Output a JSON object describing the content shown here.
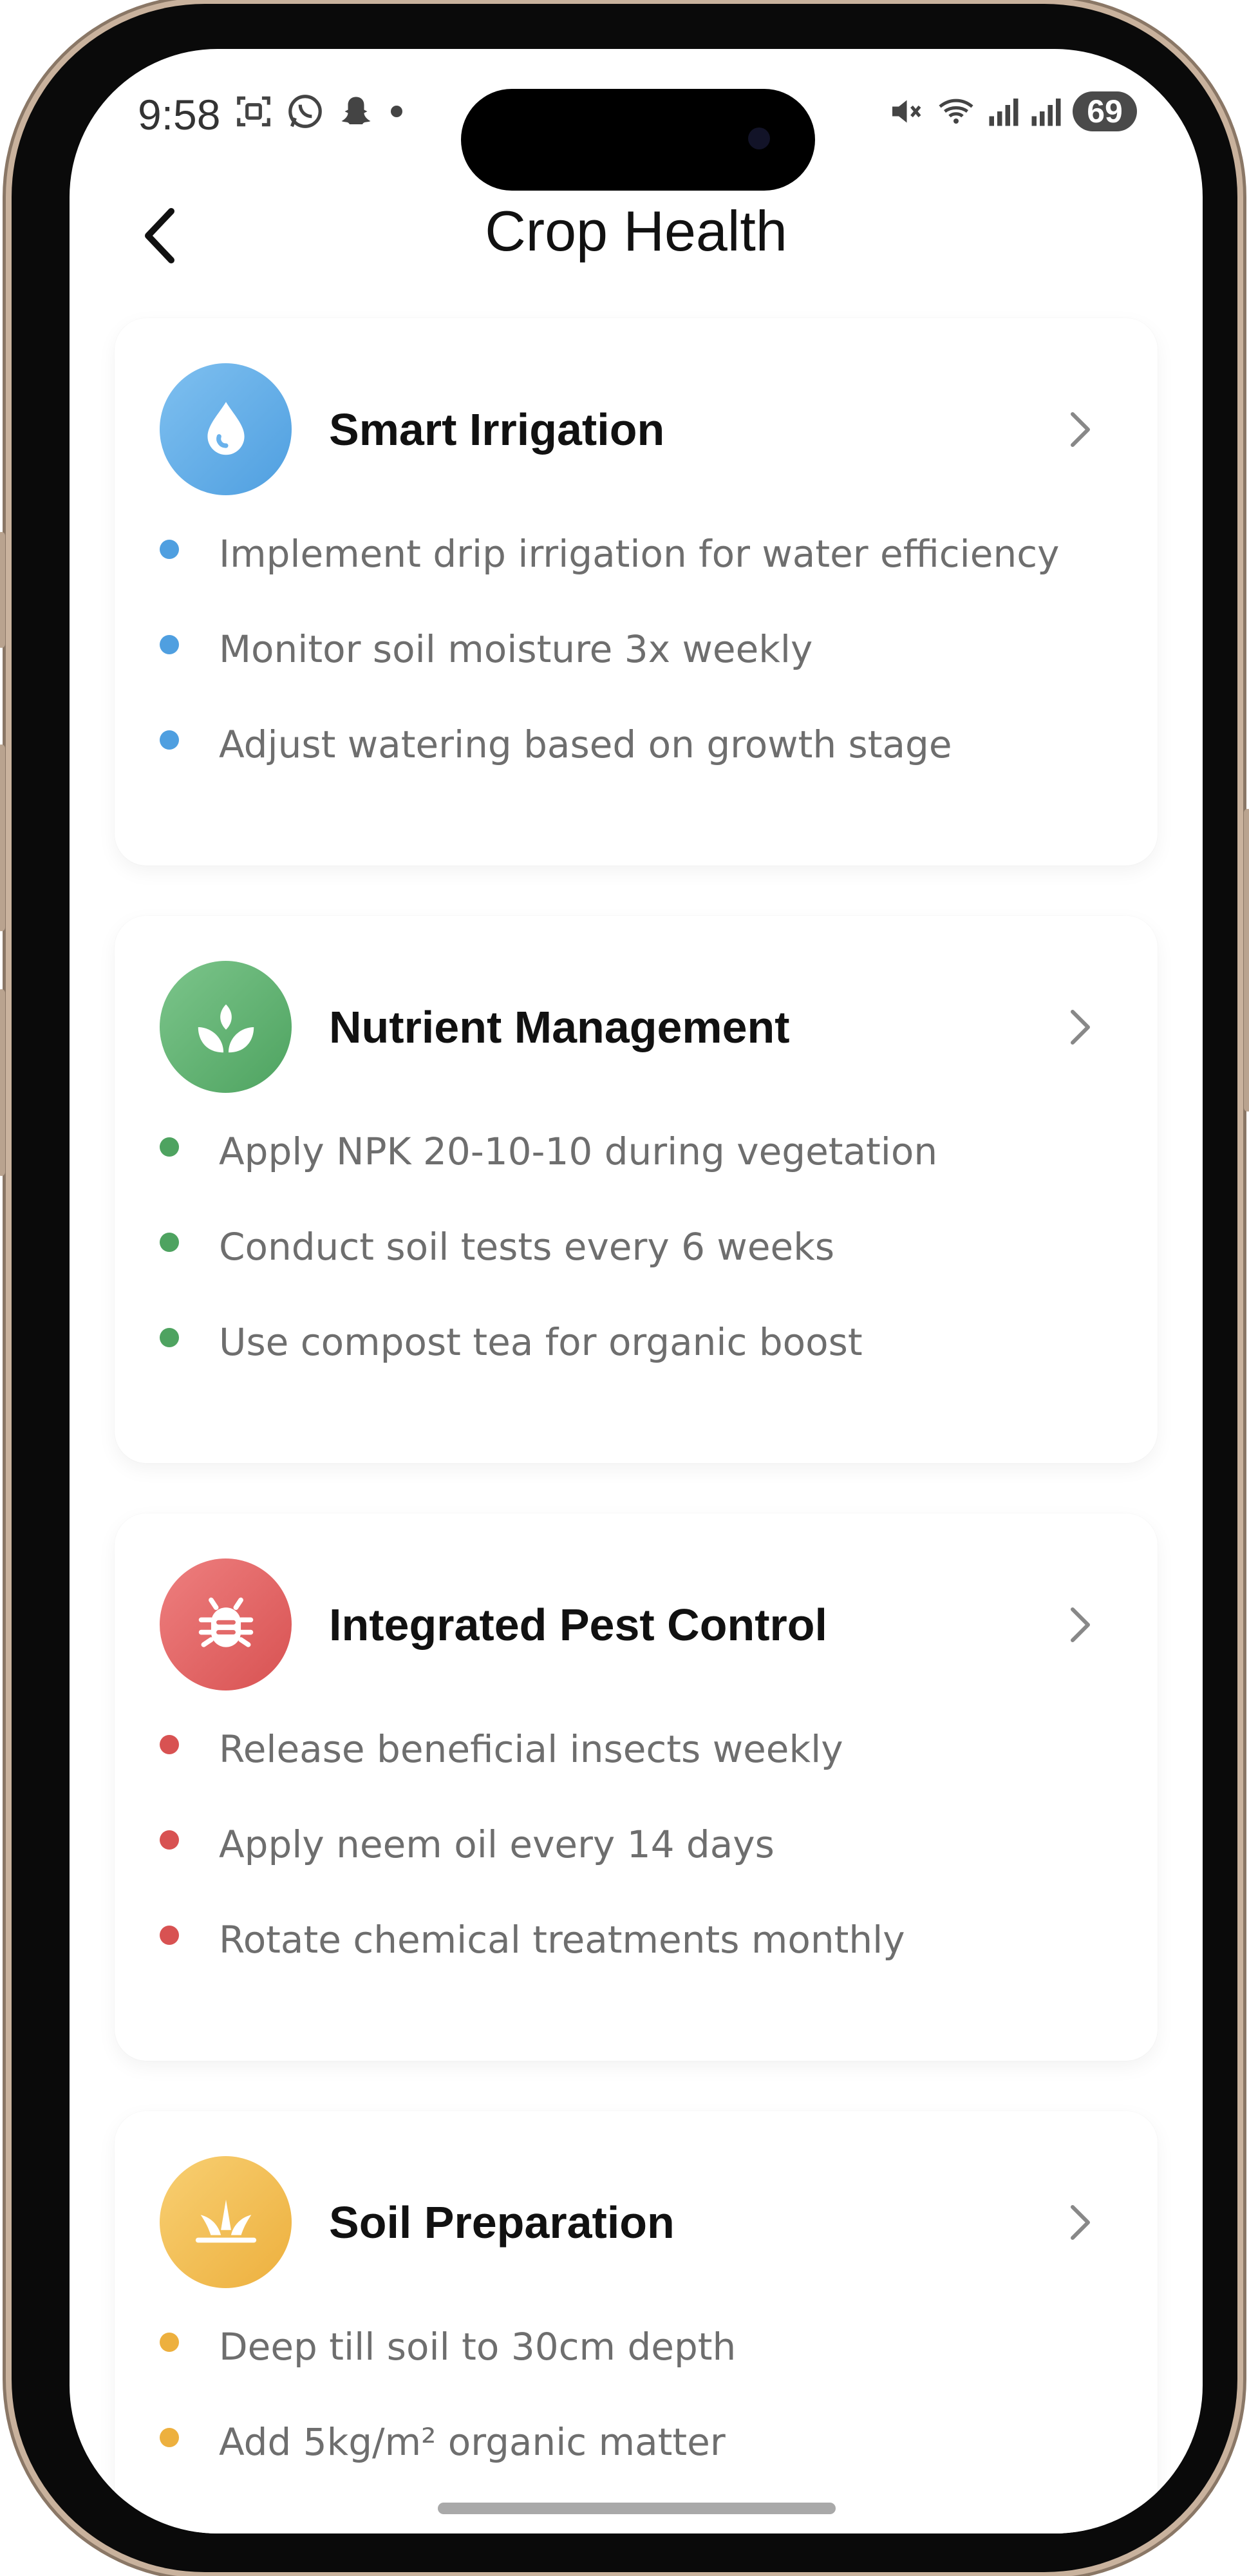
{
  "status_bar": {
    "time": "9:58",
    "battery": "69"
  },
  "header": {
    "title": "Crop Health"
  },
  "cards": [
    {
      "title": "Smart Irrigation",
      "icon": "water-drop-icon",
      "color": "#5AA8E6",
      "color_light": "#7FC0F0",
      "bullets": [
        "Implement drip irrigation for water efficiency",
        "Monitor soil moisture 3x weekly",
        "Adjust watering based on growth stage"
      ]
    },
    {
      "title": "Nutrient Management",
      "icon": "sprout-icon",
      "color": "#58AD6A",
      "color_light": "#7CC58B",
      "bullets": [
        "Apply NPK 20-10-10 during vegetation",
        "Conduct soil tests every 6 weeks",
        "Use compost tea for organic boost"
      ]
    },
    {
      "title": "Integrated Pest Control",
      "icon": "bug-icon",
      "color": "#DE5E5E",
      "color_light": "#EE7F7F",
      "bullets": [
        "Release beneficial insects weekly",
        "Apply neem oil every 14 days",
        "Rotate chemical treatments monthly"
      ]
    },
    {
      "title": "Soil Preparation",
      "icon": "grass-icon",
      "color": "#F2B94C",
      "color_light": "#F8CF72",
      "bullets": [
        "Deep till soil to 30cm depth",
        "Add 5kg/m² organic matter"
      ]
    }
  ]
}
